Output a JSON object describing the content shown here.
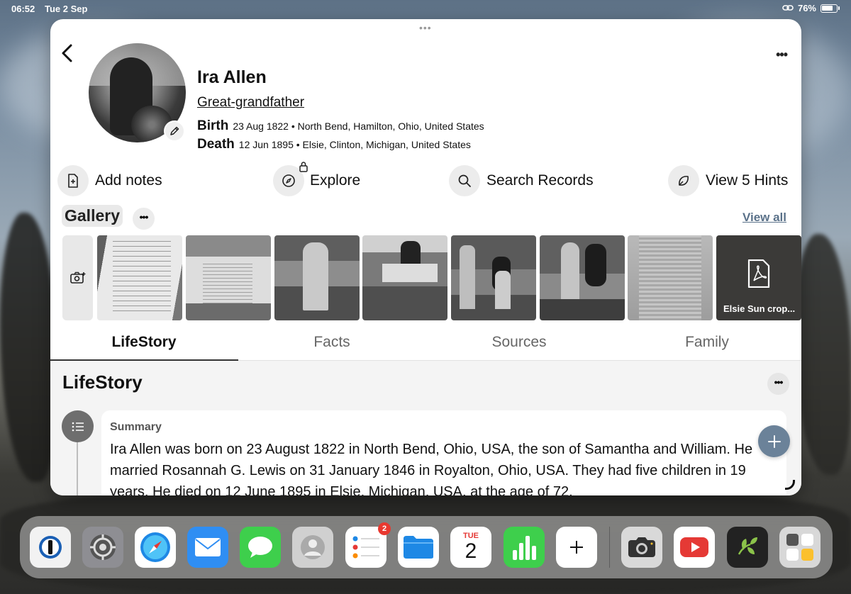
{
  "status_bar": {
    "time": "06:52",
    "date": "Tue 2 Sep",
    "battery": "76%"
  },
  "profile": {
    "name": "Ira Allen",
    "relation": "Great-grandfather",
    "birth": {
      "label": "Birth",
      "value": "23 Aug 1822 • North Bend, Hamilton, Ohio, United States"
    },
    "death": {
      "label": "Death",
      "value": "12 Jun 1895 • Elsie, Clinton, Michigan, United States"
    }
  },
  "actions": [
    {
      "label": "Add notes",
      "icon": "add-note-icon"
    },
    {
      "label": "Explore",
      "icon": "compass-icon"
    },
    {
      "label": "Search Records",
      "icon": "search-icon"
    },
    {
      "label": "View 5 Hints",
      "icon": "leaf-hint-icon"
    }
  ],
  "gallery": {
    "title": "Gallery",
    "view_all": "View all",
    "last_item_caption": "Elsie Sun crop..."
  },
  "tabs": [
    "LifeStory",
    "Facts",
    "Sources",
    "Family"
  ],
  "active_tab": "LifeStory",
  "lifestory": {
    "title": "LifeStory",
    "summary_label": "Summary",
    "summary_text": "Ira Allen was born on 23 August 1822 in North Bend, Ohio, USA, the son of Samantha and William. He married Rosannah G. Lewis on 31 January 1846 in Royalton, Ohio, USA. They had five children in 19 years. He died on 12 June 1895 in Elsie, Michigan, USA, at the age of 72."
  },
  "dock": {
    "apps": [
      "1password",
      "settings",
      "safari",
      "mail",
      "messages",
      "contacts",
      "reminders",
      "files",
      "calendar",
      "numbers",
      "add",
      "camera",
      "youtube",
      "ancestry",
      "app-library"
    ],
    "reminders_badge": "2",
    "calendar_day": "TUE",
    "calendar_date": "2"
  },
  "colors": {
    "accent": "#6b8299",
    "link": "#5a7189"
  }
}
